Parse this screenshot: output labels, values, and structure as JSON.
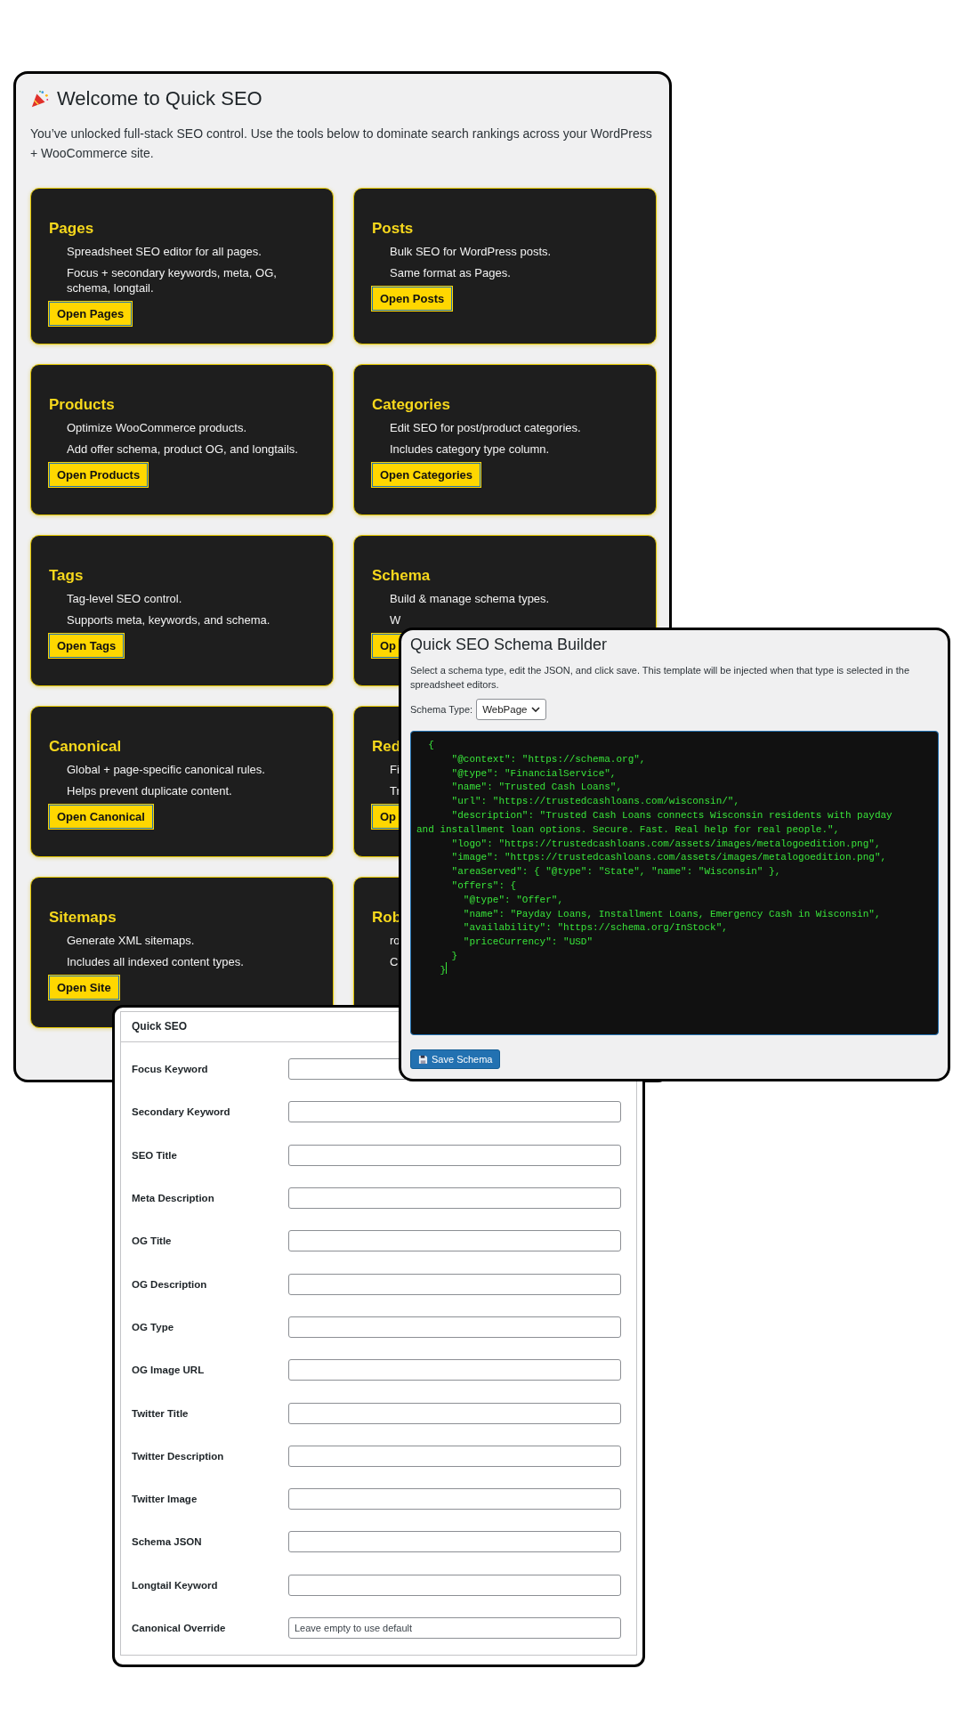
{
  "welcome": {
    "title": "Welcome to Quick SEO",
    "intro": "You’ve unlocked full-stack SEO control. Use the tools below to dominate search rankings across your WordPress + WooCommerce site.",
    "cards": [
      {
        "title": "Pages",
        "lines": [
          "Spreadsheet SEO editor for all pages.",
          "Focus + secondary keywords, meta, OG, schema, longtail."
        ],
        "button": "Open Pages"
      },
      {
        "title": "Posts",
        "lines": [
          "Bulk SEO for WordPress posts.",
          "Same format as Pages."
        ],
        "button": "Open Posts"
      },
      {
        "title": "Products",
        "lines": [
          "Optimize WooCommerce products.",
          "Add offer schema, product OG, and longtails."
        ],
        "button": "Open Products"
      },
      {
        "title": "Categories",
        "lines": [
          "Edit SEO for post/product categories.",
          "Includes category type column."
        ],
        "button": "Open Categories"
      },
      {
        "title": "Tags",
        "lines": [
          "Tag-level SEO control.",
          "Supports meta, keywords, and schema."
        ],
        "button": "Open Tags"
      },
      {
        "title": "Schema",
        "lines": [
          "Build & manage schema types.",
          "W"
        ],
        "button": "Op"
      },
      {
        "title": "Canonical",
        "lines": [
          "Global + page-specific canonical rules.",
          "Helps prevent duplicate content."
        ],
        "button": "Open Canonical"
      },
      {
        "title": "Red",
        "lines": [
          "Fi",
          "Tr"
        ],
        "button": "Op"
      },
      {
        "title": "Sitemaps",
        "lines": [
          "Generate XML sitemaps.",
          "Includes all indexed content types."
        ],
        "button": "Open Site"
      },
      {
        "title": "Rob",
        "lines": [
          "ro",
          "C"
        ]
      }
    ]
  },
  "schema_builder": {
    "title": "Quick SEO Schema Builder",
    "description": "Select a schema type, edit the JSON, and click save. This template will be injected when that type is selected in the spreadsheet editors.",
    "type_label": "Schema Type:",
    "type_value": "WebPage",
    "code_lines": [
      "  {",
      "      \"@context\": \"https://schema.org\",",
      "      \"@type\": \"FinancialService\",",
      "      \"name\": \"Trusted Cash Loans\",",
      "      \"url\": \"https://trustedcashloans.com/wisconsin/\",",
      "      \"description\": \"Trusted Cash Loans connects Wisconsin residents with payday",
      "and installment loan options. Secure. Fast. Real help for real people.\",",
      "      \"logo\": \"https://trustedcashloans.com/assets/images/metalogoedition.png\",",
      "      \"image\": \"https://trustedcashloans.com/assets/images/metalogoedition.png\",",
      "      \"areaServed\": { \"@type\": \"State\", \"name\": \"Wisconsin\" },",
      "      \"offers\": {",
      "        \"@type\": \"Offer\",",
      "        \"name\": \"Payday Loans, Installment Loans, Emergency Cash in Wisconsin\",",
      "        \"availability\": \"https://schema.org/InStock\",",
      "        \"priceCurrency\": \"USD\"",
      "      }",
      "    }"
    ],
    "save_button": "Save Schema"
  },
  "meta_box": {
    "title": "Quick SEO",
    "fields": [
      {
        "label": "Focus Keyword"
      },
      {
        "label": "Secondary Keyword"
      },
      {
        "label": "SEO Title"
      },
      {
        "label": "Meta Description"
      },
      {
        "label": "OG Title"
      },
      {
        "label": "OG Description"
      },
      {
        "label": "OG Type"
      },
      {
        "label": "OG Image URL"
      },
      {
        "label": "Twitter Title"
      },
      {
        "label": "Twitter Description"
      },
      {
        "label": "Twitter Image"
      },
      {
        "label": "Schema JSON"
      },
      {
        "label": "Longtail Keyword"
      },
      {
        "label": "Canonical Override",
        "placeholder": "Leave empty to use default"
      }
    ]
  }
}
